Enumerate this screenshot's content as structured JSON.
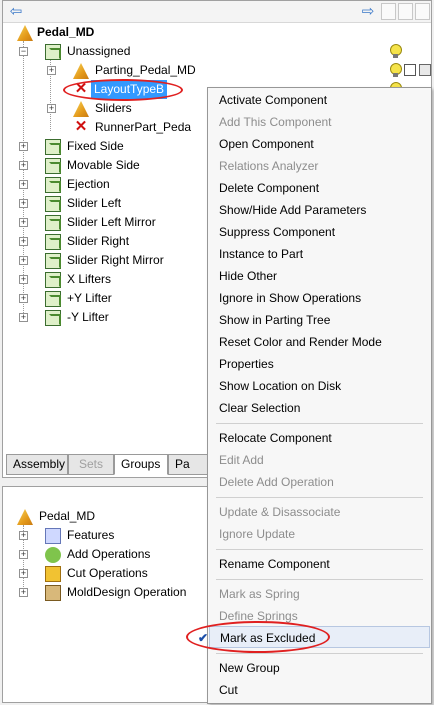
{
  "tree_top": {
    "root": "Pedal_MD",
    "unassigned": "Unassigned",
    "parting": "Parting_Pedal_MD",
    "layout": "LayoutTypeB",
    "sliders": "Sliders",
    "runner": "RunnerPart_Peda",
    "groups": [
      "Fixed Side",
      "Movable Side",
      "Ejection",
      "Slider Left",
      "Slider Left Mirror",
      "Slider Right",
      "Slider Right Mirror",
      "X Lifters",
      "+Y Lifter",
      "-Y Lifter"
    ]
  },
  "tabs": {
    "assembly": "Assembly",
    "sets": "Sets",
    "groups": "Groups",
    "partial": "Pa"
  },
  "tree_bottom": {
    "root": "Pedal_MD",
    "features": "Features",
    "add_ops": "Add Operations",
    "cut_ops": "Cut Operations",
    "mold_ops": "MoldDesign Operation"
  },
  "menu": {
    "activate": "Activate Component",
    "add_this": "Add This Component",
    "open": "Open Component",
    "relations": "Relations Analyzer",
    "delete": "Delete Component",
    "show_hide_params": "Show/Hide Add Parameters",
    "suppress": "Suppress Component",
    "instance": "Instance to Part",
    "hide_other": "Hide Other",
    "ignore_show": "Ignore in Show Operations",
    "show_parting": "Show in Parting Tree",
    "reset_color": "Reset Color and Render Mode",
    "properties": "Properties",
    "show_location": "Show Location on Disk",
    "clear_selection": "Clear Selection",
    "relocate": "Relocate Component",
    "edit_add": "Edit Add",
    "delete_add": "Delete Add Operation",
    "update_disassociate": "Update & Disassociate",
    "ignore_update": "Ignore Update",
    "rename": "Rename Component",
    "mark_spring": "Mark as Spring",
    "define_springs": "Define Springs",
    "mark_excluded": "Mark as Excluded",
    "new_group": "New Group",
    "cut": "Cut"
  },
  "colors": {
    "selection": "#3399ff",
    "annotation": "#e02020"
  }
}
